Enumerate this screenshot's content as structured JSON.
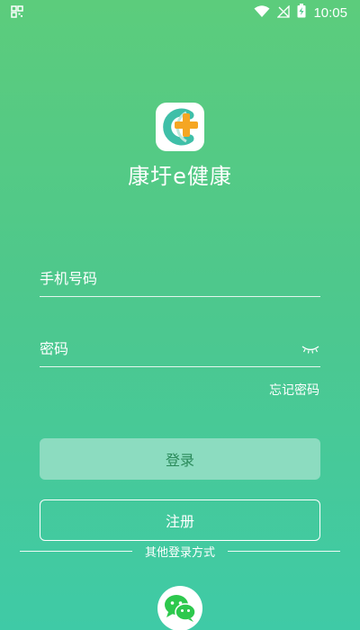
{
  "status_bar": {
    "time": "10:05",
    "icons": [
      "qr-scan-icon",
      "wifi-icon",
      "no-signal-icon",
      "battery-charging-icon"
    ]
  },
  "app": {
    "name": "康圩e健康",
    "logo_icon": "app-logo-e-plus",
    "brand_colors": {
      "green_top": "#5ccc7c",
      "teal_bottom": "#3fcaa6",
      "logo_orange": "#f5a623",
      "logo_teal": "#3fbfa8"
    }
  },
  "login_form": {
    "phone_placeholder": "手机号码",
    "phone_value": "",
    "password_placeholder": "密码",
    "password_value": "",
    "password_toggle_icon": "eye-closed-icon",
    "forgot_password": "忘记密码",
    "login_button": "登录",
    "register_button": "注册"
  },
  "other_login": {
    "label": "其他登录方式",
    "wechat_icon": "wechat-icon"
  }
}
